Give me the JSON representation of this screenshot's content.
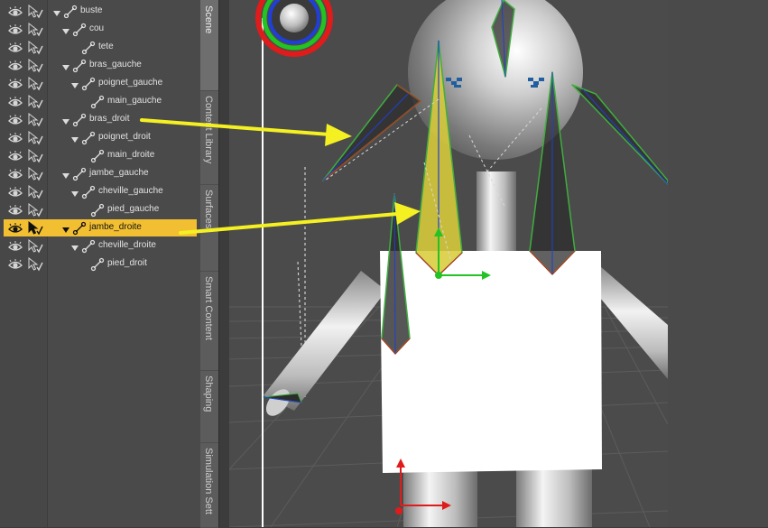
{
  "scene": {
    "items": [
      {
        "label": "buste",
        "depth": 0,
        "expanded": true,
        "selected": false
      },
      {
        "label": "cou",
        "depth": 1,
        "expanded": true,
        "selected": false
      },
      {
        "label": "tete",
        "depth": 2,
        "expanded": false,
        "selected": false
      },
      {
        "label": "bras_gauche",
        "depth": 1,
        "expanded": true,
        "selected": false
      },
      {
        "label": "poignet_gauche",
        "depth": 2,
        "expanded": true,
        "selected": false
      },
      {
        "label": "main_gauche",
        "depth": 3,
        "expanded": false,
        "selected": false
      },
      {
        "label": "bras_droit",
        "depth": 1,
        "expanded": true,
        "selected": false
      },
      {
        "label": "poignet_droit",
        "depth": 2,
        "expanded": true,
        "selected": false
      },
      {
        "label": "main_droite",
        "depth": 3,
        "expanded": false,
        "selected": false
      },
      {
        "label": "jambe_gauche",
        "depth": 1,
        "expanded": true,
        "selected": false
      },
      {
        "label": "cheville_gauche",
        "depth": 2,
        "expanded": true,
        "selected": false
      },
      {
        "label": "pied_gauche",
        "depth": 3,
        "expanded": false,
        "selected": false
      },
      {
        "label": "jambe_droite",
        "depth": 1,
        "expanded": true,
        "selected": true
      },
      {
        "label": "cheville_droite",
        "depth": 2,
        "expanded": true,
        "selected": false
      },
      {
        "label": "pied_droit",
        "depth": 3,
        "expanded": false,
        "selected": false
      }
    ]
  },
  "tabs": [
    {
      "label": "Scene",
      "active": true
    },
    {
      "label": "Content Library",
      "active": false
    },
    {
      "label": "Surfaces",
      "active": false
    },
    {
      "label": "Smart Content",
      "active": false
    },
    {
      "label": "Shaping",
      "active": false
    },
    {
      "label": "Simulation Sett",
      "active": false
    }
  ],
  "colors": {
    "selection": "#f2bf32",
    "annotation_arrow": "#f5f022",
    "bone_highlight": "#d8cc3a"
  }
}
